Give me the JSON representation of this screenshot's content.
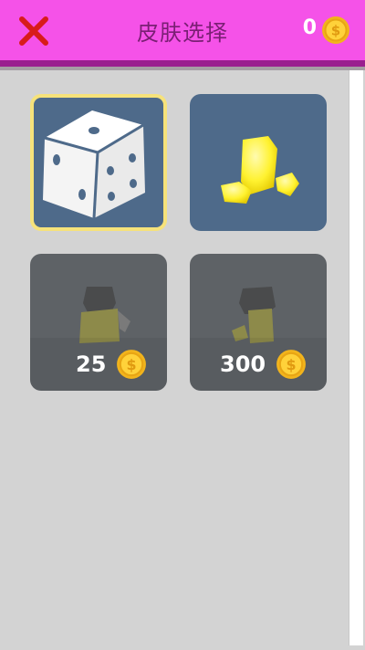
{
  "header": {
    "title": "皮肤选择",
    "coins": "0",
    "close_icon": "close-x-icon",
    "coin_icon": "gold-coin-icon"
  },
  "colors": {
    "header_bg": "#f552e8",
    "header_border": "#9a1f8f",
    "page_bg": "#d3d3d3",
    "tile_bg": "#4e6a8a",
    "locked_tile_bg": "#5e6266",
    "selected_border": "#f6e27a",
    "close_icon": "#d81b1b"
  },
  "skins": [
    {
      "name": "dice",
      "icon": "dice-icon",
      "state": "selected"
    },
    {
      "name": "yellow-crystals",
      "icon": "crystal-icon",
      "state": "owned"
    },
    {
      "name": "yellow-figure-a",
      "icon": "figure-icon",
      "state": "locked",
      "price": "25"
    },
    {
      "name": "yellow-figure-b",
      "icon": "figure-icon",
      "state": "locked",
      "price": "300"
    }
  ]
}
